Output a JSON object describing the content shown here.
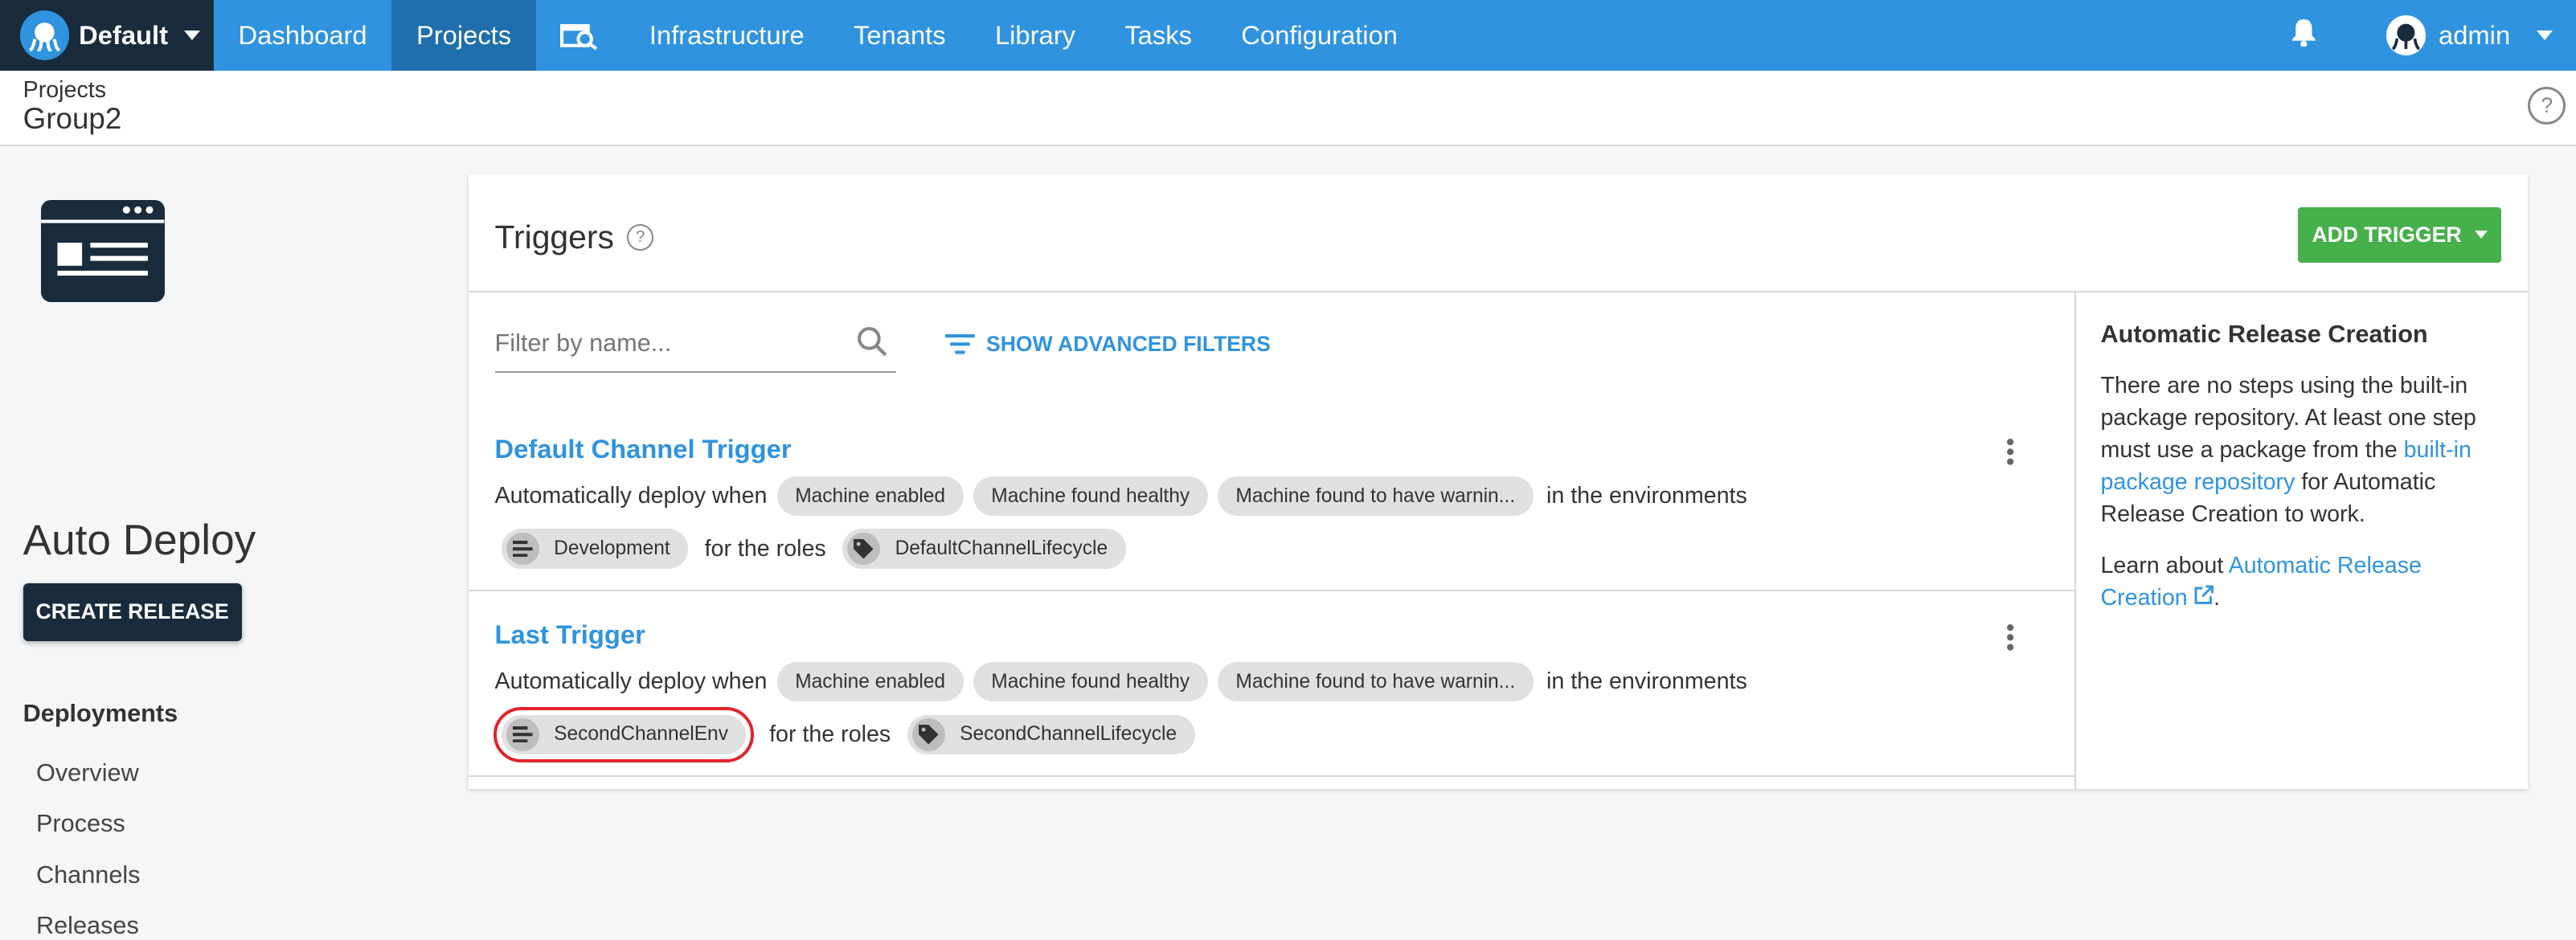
{
  "brand": {
    "label": "Default"
  },
  "nav": {
    "items": [
      "Dashboard",
      "Projects",
      "Infrastructure",
      "Tenants",
      "Library",
      "Tasks",
      "Configuration"
    ],
    "active": "Projects"
  },
  "user": {
    "name": "admin"
  },
  "breadcrumb": "Projects",
  "page_title": "Group2",
  "project": {
    "name": "Auto Deploy",
    "create_release": "CREATE RELEASE",
    "section_heading": "Deployments",
    "links": [
      "Overview",
      "Process",
      "Channels",
      "Releases"
    ]
  },
  "triggers": {
    "title": "Triggers",
    "add_button": "ADD TRIGGER",
    "filter_placeholder": "Filter by name...",
    "advanced_filters": "SHOW ADVANCED FILTERS",
    "items": [
      {
        "name": "Default Channel Trigger",
        "prefix": "Automatically deploy when",
        "events": [
          "Machine enabled",
          "Machine found healthy",
          "Machine found to have warnin..."
        ],
        "env_text": "in the environments",
        "environment": "Development",
        "roles_text": "for the roles",
        "role": "DefaultChannelLifecycle"
      },
      {
        "name": "Last Trigger",
        "prefix": "Automatically deploy when",
        "events": [
          "Machine enabled",
          "Machine found healthy",
          "Machine found to have warnin..."
        ],
        "env_text": "in the environments",
        "environment": "SecondChannelEnv",
        "roles_text": "for the roles",
        "role": "SecondChannelLifecycle"
      }
    ]
  },
  "info_panel": {
    "heading": "Automatic Release Creation",
    "para1_a": "There are no steps using the built-in package repository. At least one step must use a package from the ",
    "para1_link": "built-in package repository",
    "para1_b": " for Automatic Release Creation to work.",
    "para2_a": "Learn about ",
    "para2_link": "Automatic Release Creation",
    "para2_b": "."
  },
  "colors": {
    "topbar": "#2f93e0",
    "brand_bg": "#1a2b3c",
    "accent_green": "#46b04a",
    "highlight": "#e0252b"
  }
}
